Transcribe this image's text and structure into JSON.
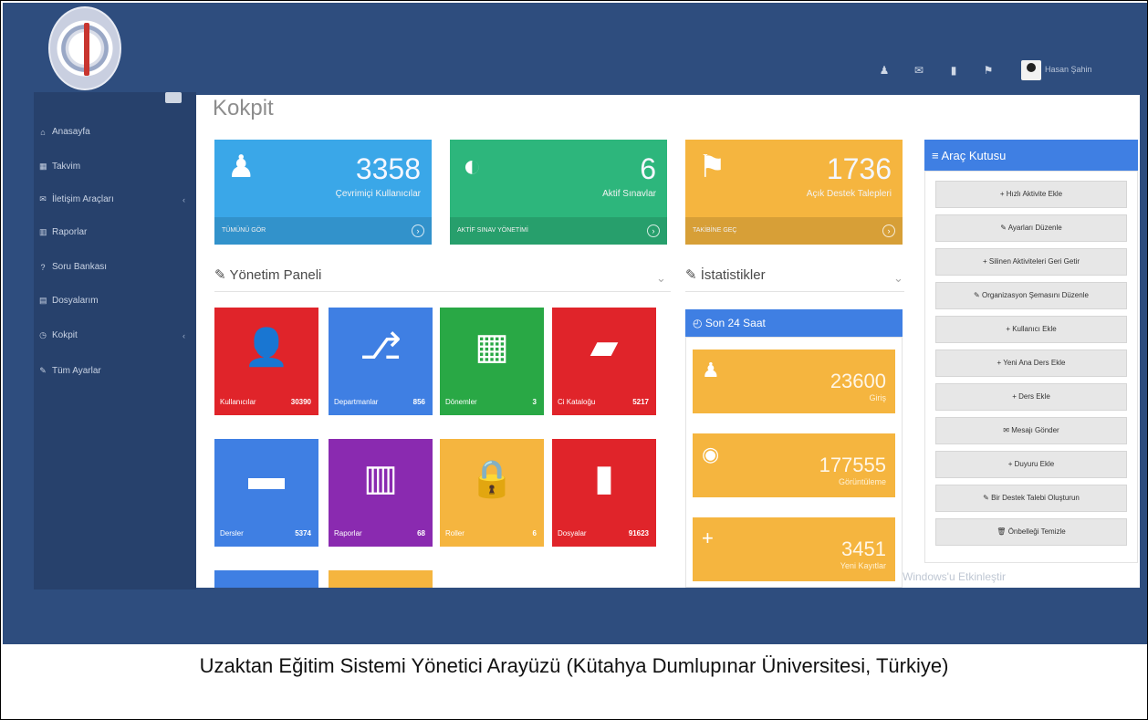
{
  "caption": "Uzaktan Eğitim Sistemi Yönetici Arayüzü (Kütahya Dumlupınar Üniversitesi, Türkiye)",
  "header": {
    "icons": [
      "user-icon",
      "envelope-icon",
      "bookmark-icon",
      "flag-icon"
    ],
    "username": "Hasan Şahin"
  },
  "sidebar": {
    "items": [
      {
        "icon": "home-icon",
        "glyph": "⌂",
        "label": "Anasayfa"
      },
      {
        "icon": "calendar-icon",
        "glyph": "▦",
        "label": "Takvim"
      },
      {
        "icon": "envelope-icon",
        "glyph": "✉",
        "label": "İletişim Araçları",
        "chevron": true
      },
      {
        "icon": "chart-icon",
        "glyph": "▥",
        "label": "Raporlar"
      },
      {
        "icon": "question-icon",
        "glyph": "?",
        "label": "Soru Bankası"
      },
      {
        "icon": "file-icon",
        "glyph": "▤",
        "label": "Dosyalarım"
      },
      {
        "icon": "dashboard-icon",
        "glyph": "◷",
        "label": "Kokpit",
        "chevron": true
      },
      {
        "icon": "wrench-icon",
        "glyph": "✎",
        "label": "Tüm Ayarlar"
      }
    ]
  },
  "page_title": "Kokpit",
  "stat_cards": [
    {
      "value": "3358",
      "label": "Çevrimiçi Kullanıcılar",
      "footer": "TÜMÜNÜ GÖR",
      "color": "#3aa7e8",
      "icon": "user-icon"
    },
    {
      "value": "6",
      "label": "Aktif Sınavlar",
      "footer": "AKTİF SINAV YÖNETİMİ",
      "color": "#2db67c",
      "icon": "dashboard-icon"
    },
    {
      "value": "1736",
      "label": "Açık Destek Talepleri",
      "footer": "TAKİBİNE GEÇ",
      "color": "#f5b53f",
      "icon": "flag-icon"
    }
  ],
  "management_panel": {
    "title": "Yönetim Paneli",
    "tiles": [
      {
        "label": "Kullanıcılar",
        "count": "30390",
        "color": "#e0242a",
        "icon": "user-icon",
        "glyph": "👤"
      },
      {
        "label": "Departmanlar",
        "count": "856",
        "color": "#3f7fe3",
        "icon": "sitemap-icon",
        "glyph": "⎇"
      },
      {
        "label": "Dönemler",
        "count": "3",
        "color": "#29a845",
        "icon": "calendar-icon",
        "glyph": "▦"
      },
      {
        "label": "Ci Kataloğu",
        "count": "5217",
        "color": "#e0242a",
        "icon": "folder-open-icon",
        "glyph": "▰"
      },
      {
        "label": "Dersler",
        "count": "5374",
        "color": "#3f7fe3",
        "icon": "book-icon",
        "glyph": "▬"
      },
      {
        "label": "Raporlar",
        "count": "68",
        "color": "#8a2ab0",
        "icon": "bar-chart-icon",
        "glyph": "▥"
      },
      {
        "label": "Roller",
        "count": "6",
        "color": "#f5b53f",
        "icon": "lock-icon",
        "glyph": "🔒"
      },
      {
        "label": "Dosyalar",
        "count": "91623",
        "color": "#e0242a",
        "icon": "file-icon",
        "glyph": "▮"
      }
    ],
    "partial_tiles": [
      {
        "color": "#3f7fe3"
      },
      {
        "color": "#f5b53f"
      }
    ]
  },
  "statistics_panel": {
    "title": "İstatistikler",
    "box_title": "Son 24 Saat",
    "items": [
      {
        "value": "23600",
        "label": "Giriş",
        "icon": "user-icon",
        "glyph": "♟"
      },
      {
        "value": "177555",
        "label": "Görüntüleme",
        "icon": "eye-icon",
        "glyph": "◉"
      },
      {
        "value": "3451",
        "label": "Yeni Kayıtlar",
        "icon": "plus-icon",
        "glyph": "+"
      }
    ]
  },
  "toolbox": {
    "title": "Araç Kutusu",
    "buttons": [
      {
        "glyph": "+",
        "label": "Hızlı Aktivite Ekle"
      },
      {
        "glyph": "✎",
        "label": "Ayarları Düzenle"
      },
      {
        "glyph": "+",
        "label": "Silinen Aktiviteleri Geri Getir"
      },
      {
        "glyph": "✎",
        "label": "Organizasyon Şemasını Düzenle"
      },
      {
        "glyph": "+",
        "label": "Kullanıcı Ekle"
      },
      {
        "glyph": "+",
        "label": "Yeni Ana Ders Ekle"
      },
      {
        "glyph": "+",
        "label": "Ders Ekle"
      },
      {
        "glyph": "✉",
        "label": "Mesajı Gönder"
      },
      {
        "glyph": "+",
        "label": "Duyuru Ekle"
      },
      {
        "glyph": "✎",
        "label": "Bir Destek Talebi Oluşturun"
      },
      {
        "glyph": "🗑",
        "label": "Önbelleği Temizle"
      }
    ]
  },
  "watermark": "Windows'u Etkinleştir"
}
